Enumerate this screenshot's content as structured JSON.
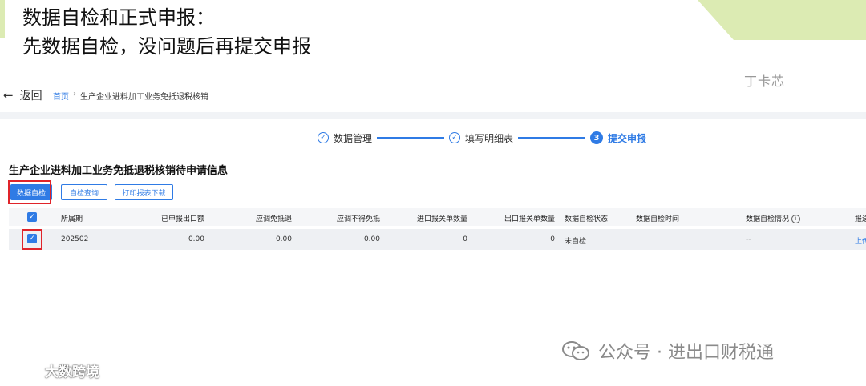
{
  "slide": {
    "title_line1": "数据自检和正式申报：",
    "title_line2": "先数据自检，没问题后再提交申报",
    "corner_mark": "丁卡芯"
  },
  "nav": {
    "back_label": "返回",
    "breadcrumb_home": "首页",
    "breadcrumb_sep": "›",
    "breadcrumb_current": "生产企业进料加工业务免抵退税核销"
  },
  "steps": [
    {
      "label": "数据管理",
      "state": "done",
      "icon": "✓"
    },
    {
      "label": "填写明细表",
      "state": "done",
      "icon": "✓"
    },
    {
      "label": "提交申报",
      "state": "active",
      "icon": "3"
    }
  ],
  "section": {
    "title": "生产企业进料加工业务免抵退税核销待申请信息",
    "buttons": {
      "self_check": "数据自检",
      "check_query": "自检查询",
      "print_download": "打印报表下载"
    }
  },
  "table": {
    "headers": [
      "所属期",
      "已申报出口额",
      "应调免抵退",
      "应调不得免抵",
      "进口报关单数量",
      "出口报关单数量",
      "数据自检状态",
      "数据自检时间",
      "数据自检情况",
      "报送"
    ],
    "rows": [
      {
        "period": "202502",
        "declared_export": "0.00",
        "adj_exempt": "0.00",
        "adj_not_exempt": "0.00",
        "import_count": "0",
        "export_count": "0",
        "status": "未自检",
        "check_time": "",
        "check_result": "--",
        "action": "上传"
      }
    ]
  },
  "watermarks": {
    "right": "公众号 · 进出口财税通",
    "left": "大数跨境"
  },
  "colors": {
    "accent": "#2f7be5",
    "highlight": "#e0242a",
    "deco": "#dcebb3"
  }
}
